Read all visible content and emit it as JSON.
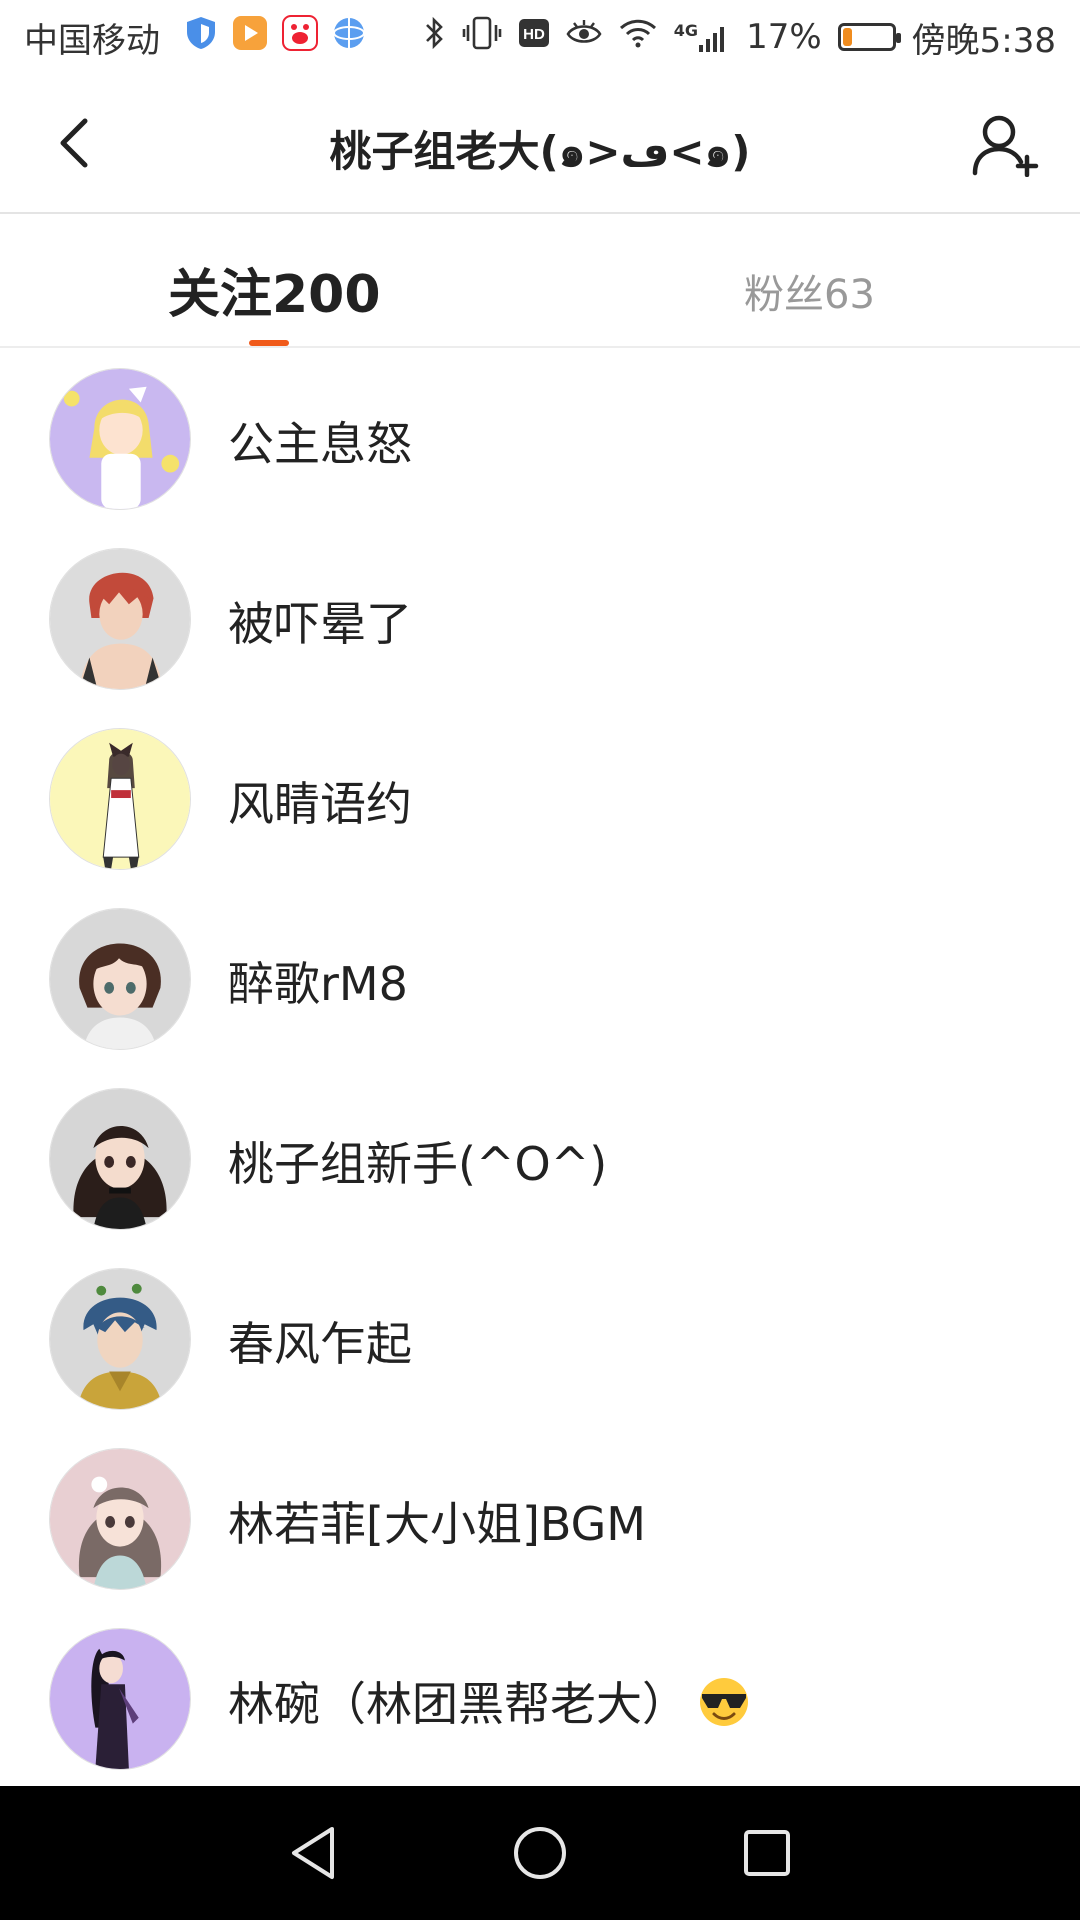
{
  "status_bar": {
    "carrier": "中国移动",
    "battery_percent": "17%",
    "battery_level": 0.17,
    "time": "傍晚5:38",
    "network": "4G",
    "icons": [
      "shield-icon",
      "video-app-icon",
      "baidu-icon",
      "browser-icon",
      "bluetooth-icon",
      "vibrate-icon",
      "hd-icon",
      "eye-icon",
      "wifi-icon",
      "signal-icon",
      "battery-icon"
    ]
  },
  "header": {
    "title": "桃子组老大(๑>ڡ<๑)",
    "back_icon": "chevron-left-icon",
    "add_icon": "add-user-icon"
  },
  "tabs": [
    {
      "label": "关注200",
      "active": true
    },
    {
      "label": "粉丝63",
      "active": false
    }
  ],
  "colors": {
    "accent": "#f05a1a",
    "avatar_1": "#c9b8f0",
    "avatar_2": "#dcdcdc",
    "avatar_3": "#fbf7b9",
    "avatar_4": "#d8d8d8",
    "avatar_5": "#d6d6d6",
    "avatar_6": "#d9d9d9",
    "avatar_7": "#e8cfd2",
    "avatar_8": "#c9b2f0"
  },
  "users": [
    {
      "name": "公主息怒"
    },
    {
      "name": "被吓晕了"
    },
    {
      "name": "风睛语约"
    },
    {
      "name": "醉歌rM8"
    },
    {
      "name": "桃子组新手(^O^)"
    },
    {
      "name": "春风乍起"
    },
    {
      "name": "林若菲[大小姐]BGM"
    },
    {
      "name": "林碗（林团黑帮老大）",
      "emoji": "sunglasses-emoji"
    }
  ],
  "nav_bar": {
    "buttons": [
      "back-triangle-icon",
      "home-circle-icon",
      "recents-square-icon"
    ]
  }
}
